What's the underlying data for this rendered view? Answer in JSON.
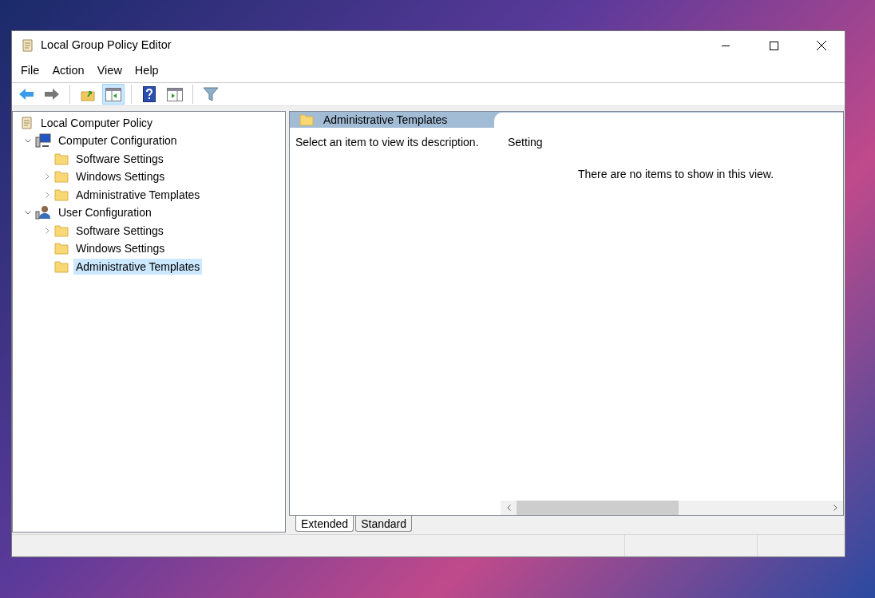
{
  "window": {
    "title": "Local Group Policy Editor"
  },
  "menu": [
    "File",
    "Action",
    "View",
    "Help"
  ],
  "toolbar": [
    {
      "kind": "back",
      "pressed": false
    },
    {
      "kind": "forward",
      "pressed": false
    },
    {
      "kind": "sep"
    },
    {
      "kind": "up",
      "pressed": false
    },
    {
      "kind": "tree",
      "pressed": true
    },
    {
      "kind": "sep"
    },
    {
      "kind": "help",
      "pressed": false
    },
    {
      "kind": "pane",
      "pressed": false
    },
    {
      "kind": "sep"
    },
    {
      "kind": "filter",
      "pressed": false
    }
  ],
  "tree": [
    {
      "label": "Local Computer Policy",
      "kind": "policy",
      "selected": false,
      "children": [
        {
          "label": "Computer Configuration",
          "kind": "computer",
          "expanded": true,
          "selected": false,
          "children": [
            {
              "label": "Software Settings",
              "kind": "folder",
              "selected": false
            },
            {
              "label": "Windows Settings",
              "kind": "folder",
              "expanded": false,
              "selected": false
            },
            {
              "label": "Administrative Templates",
              "kind": "folder",
              "expanded": false,
              "selected": false
            }
          ]
        },
        {
          "label": "User Configuration",
          "kind": "user",
          "expanded": true,
          "selected": false,
          "children": [
            {
              "label": "Software Settings",
              "kind": "folder",
              "expanded": false,
              "selected": false
            },
            {
              "label": "Windows Settings",
              "kind": "folder",
              "selected": false
            },
            {
              "label": "Administrative Templates",
              "kind": "folder",
              "selected": true
            }
          ]
        }
      ]
    }
  ],
  "details": {
    "header": "Administrative Templates",
    "description": "Select an item to view its description.",
    "column": "Setting",
    "empty_message": "There are no items to show in this view."
  },
  "tabs": [
    {
      "label": "Extended",
      "selected": true
    },
    {
      "label": "Standard",
      "selected": false
    }
  ]
}
